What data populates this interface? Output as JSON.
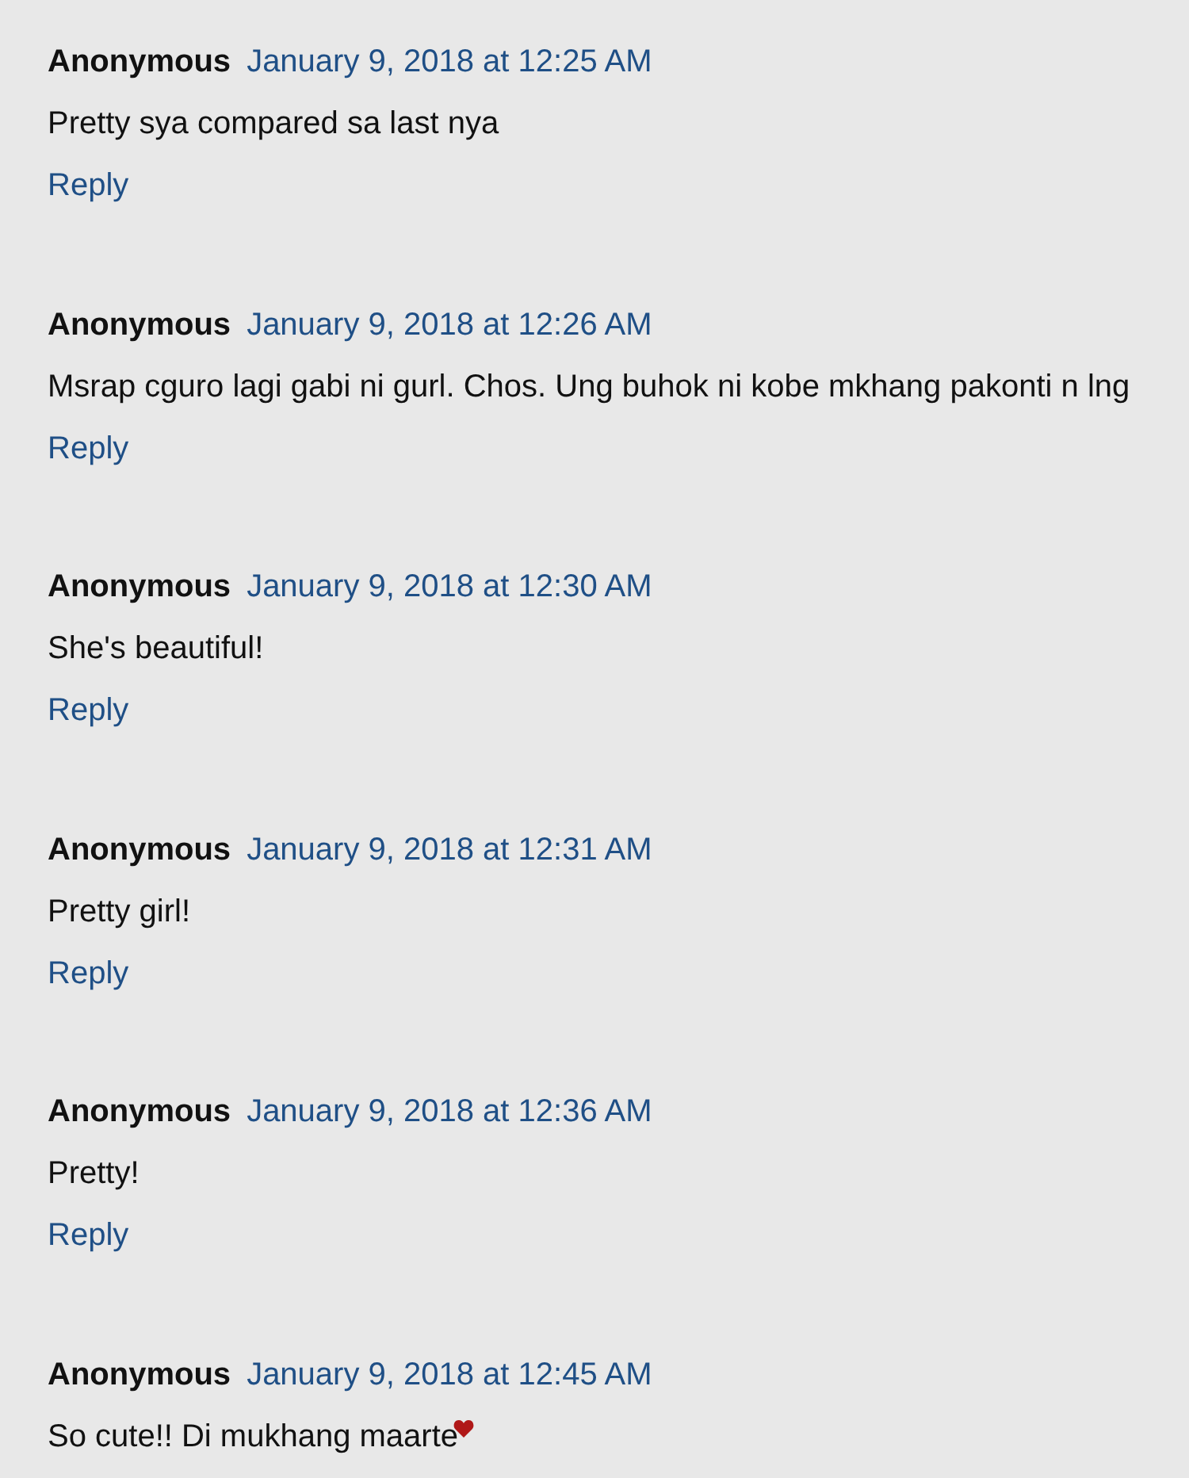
{
  "comments": [
    {
      "author": "Anonymous",
      "date": "January 9, 2018 at 12:25 AM",
      "text": "Pretty sya compared sa last nya",
      "emoji": false,
      "reply": "Reply"
    },
    {
      "author": "Anonymous",
      "date": "January 9, 2018 at 12:26 AM",
      "text": "Msrap cguro lagi gabi ni gurl. Chos. Ung buhok ni kobe mkhang pakonti n lng",
      "emoji": false,
      "reply": "Reply"
    },
    {
      "author": "Anonymous",
      "date": "January 9, 2018 at 12:30 AM",
      "text": "She's beautiful!",
      "emoji": false,
      "reply": "Reply"
    },
    {
      "author": "Anonymous",
      "date": "January 9, 2018 at 12:31 AM",
      "text": "Pretty girl!",
      "emoji": false,
      "reply": "Reply"
    },
    {
      "author": "Anonymous",
      "date": "January 9, 2018 at 12:36 AM",
      "text": "Pretty!",
      "emoji": false,
      "reply": "Reply"
    },
    {
      "author": "Anonymous",
      "date": "January 9, 2018 at 12:45 AM",
      "text": "So cute!! Di mukhang maarte",
      "emoji": true
    }
  ]
}
